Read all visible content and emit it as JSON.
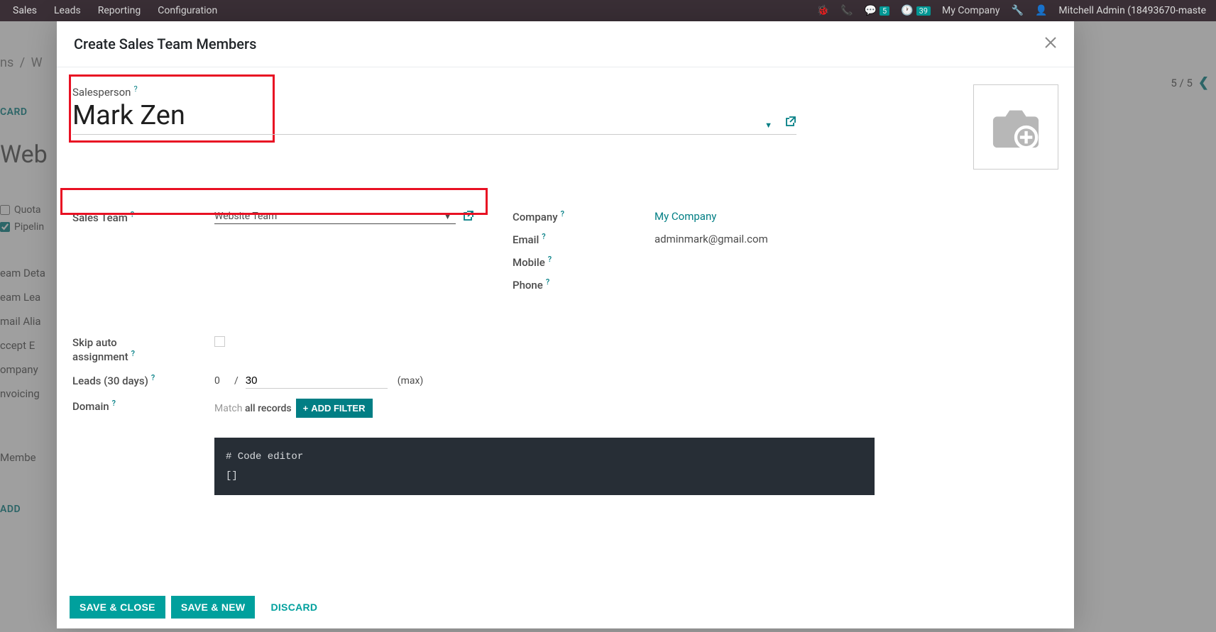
{
  "topbar": {
    "nav": [
      "Sales",
      "Leads",
      "Reporting",
      "Configuration"
    ],
    "msg_badge": "5",
    "activity_badge": "39",
    "company": "My Company",
    "user": "Mitchell Admin (18493670-maste"
  },
  "bg": {
    "breadcrumb_1": "ns",
    "breadcrumb_2": "W",
    "title": "Web",
    "discard": "CARD",
    "check_1": "Quota",
    "check_2": "Pipelin",
    "labels": [
      "eam Deta",
      "eam Lea",
      "mail Alia",
      "ccept E",
      "ompany",
      "nvoicing"
    ],
    "members": "Membe",
    "add": "ADD",
    "pager": "5 / 5"
  },
  "modal": {
    "title": "Create Sales Team Members",
    "salesperson_label": "Salesperson",
    "salesperson_value": "Mark Zen",
    "sales_team_label": "Sales Team",
    "sales_team_value": "Website Team",
    "company_label": "Company",
    "company_value": "My Company",
    "email_label": "Email",
    "email_value": "adminmark@gmail.com",
    "mobile_label": "Mobile",
    "phone_label": "Phone",
    "skip_label_1": "Skip auto",
    "skip_label_2": "assignment",
    "leads_label": "Leads (30 days)",
    "leads_zero": "0",
    "leads_max_value": "30",
    "leads_max_text": "(max)",
    "domain_label": "Domain",
    "match_prefix": "Match ",
    "match_bold": "all records",
    "add_filter": "ADD FILTER",
    "code_comment": "# Code editor",
    "code_value": "[]",
    "save_close": "SAVE & CLOSE",
    "save_new": "SAVE & NEW",
    "discard_btn": "DISCARD"
  }
}
